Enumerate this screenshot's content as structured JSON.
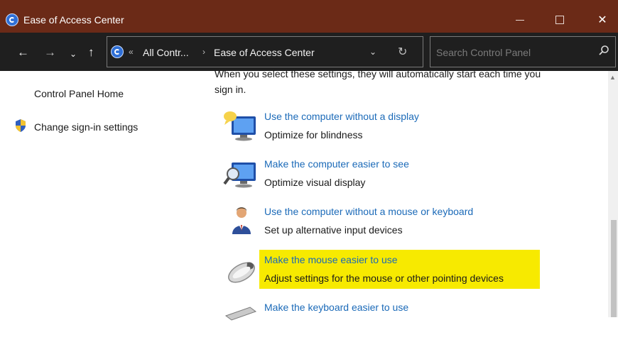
{
  "window": {
    "title": "Ease of Access Center",
    "minimize_glyph": "—",
    "maximize_glyph": "☐",
    "close_glyph": "✕"
  },
  "nav": {
    "back_glyph": "←",
    "forward_glyph": "→",
    "recent_glyph": "⌄",
    "up_glyph": "↑"
  },
  "address": {
    "overflow": "«",
    "crumb_1": "All Contr...",
    "separator": "›",
    "crumb_2": "Ease of Access Center",
    "dropdown_glyph": "⌄",
    "refresh_glyph": "↻"
  },
  "search": {
    "placeholder": "Search Control Panel"
  },
  "sidebar": {
    "home": "Control Panel Home",
    "signin": "Change sign-in settings"
  },
  "main": {
    "intro_line_1": "When you select these settings, they will automatically start each time you",
    "intro_line_2": "sign in.",
    "tasks": [
      {
        "title": "Use the computer without a display",
        "desc": "Optimize for blindness"
      },
      {
        "title": "Make the computer easier to see",
        "desc": "Optimize visual display"
      },
      {
        "title": "Use the computer without a mouse or keyboard",
        "desc": "Set up alternative input devices"
      },
      {
        "title": "Make the mouse easier to use",
        "desc": "Adjust settings for the mouse or other pointing devices"
      },
      {
        "title": "Make the keyboard easier to use",
        "desc": ""
      }
    ]
  },
  "colors": {
    "titlebar": "#6b2a17",
    "addressbar": "#1f1f1f",
    "link": "#1b6ab8",
    "highlight": "#f7ea00"
  },
  "icons": {
    "app": "ease-of-access-icon",
    "search": "search-icon",
    "shield": "uac-shield-icon"
  }
}
